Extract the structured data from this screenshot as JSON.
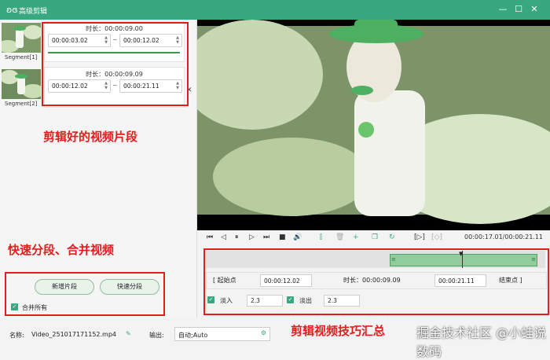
{
  "window": {
    "title": "高级剪辑",
    "minimize": "—",
    "maximize": "☐",
    "close": "✕"
  },
  "segments": [
    {
      "caption": "Segment[1]",
      "duration": "时长：00:00:09.00",
      "start": "00:00:03.02",
      "end": "00:00:12.02"
    },
    {
      "caption": "Segment[2]",
      "duration": "时长：00:00:09.09",
      "start": "00:00:12.02",
      "end": "00:00:21.11"
    }
  ],
  "tilde": "~",
  "annotations": {
    "clips_label": "剪辑好的视频片段",
    "split_label": "快速分段、合并视频",
    "bottom_label": "剪辑视频技巧汇总",
    "watermark": "掘金技术社区 @小蛙说数码"
  },
  "left_actions": {
    "new_segment": "新增片段",
    "quick_split": "快速分段",
    "merge_all": "合并所有"
  },
  "player": {
    "time_display": "00:00:17.01/00:00:21.11"
  },
  "range": {
    "start_btn": "[ 起始点",
    "start_time": "00:00:12.02",
    "duration": "时长：00:00:09.09",
    "end_time": "00:00:21.11",
    "end_btn": "结束点 ]"
  },
  "fade": {
    "fade_in_label": "淡入",
    "fade_in_value": "2.3",
    "fade_out_label": "淡出",
    "fade_out_value": "2.3"
  },
  "footer": {
    "name_label": "名称:",
    "filename": "Video_251017171152.mp4",
    "output_label": "输出:",
    "output_value": "自动;Auto"
  },
  "colors": {
    "accent": "#3aa87f",
    "annotation": "#e31c1c",
    "segment_fill": "#8fce9c"
  }
}
